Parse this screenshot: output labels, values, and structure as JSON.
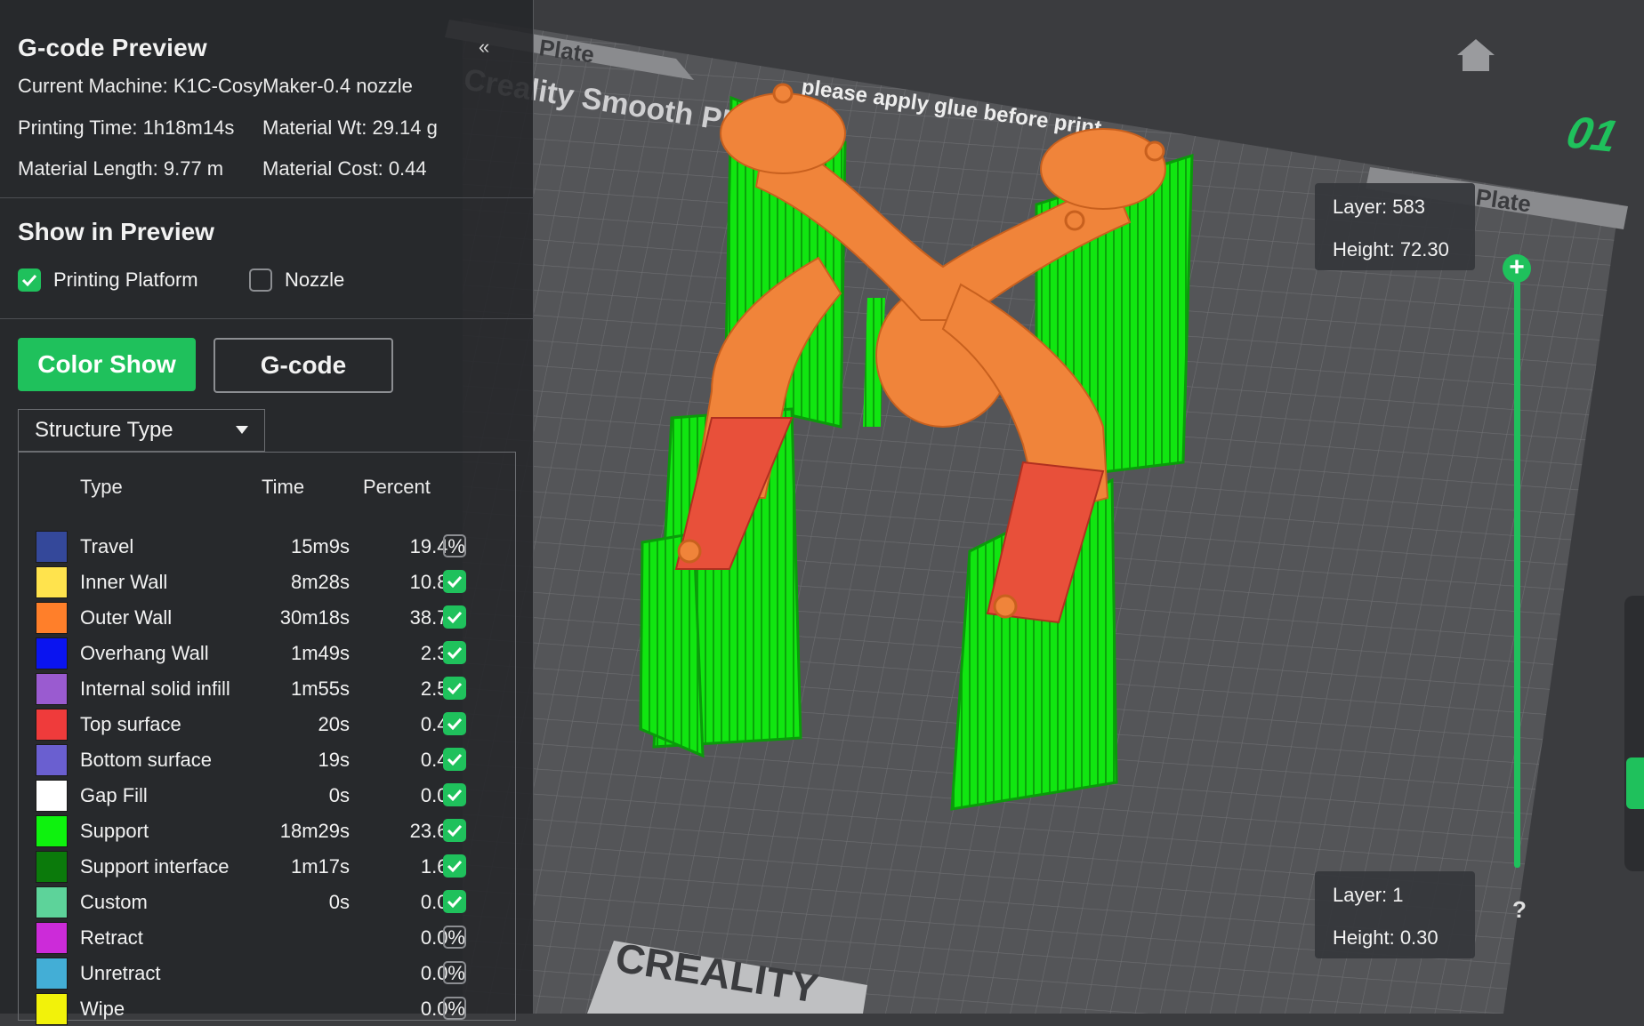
{
  "panel": {
    "title": "G-code Preview",
    "machine": "Current Machine: K1C-CosyMaker-0.4 nozzle",
    "printing_time": "Printing Time: 1h18m14s",
    "material_wt": "Material Wt: 29.14 g",
    "material_length": "Material Length: 9.77 m",
    "material_cost": "Material Cost: 0.44",
    "collapse_icon": "«"
  },
  "show_in_preview": {
    "title": "Show in Preview",
    "printing_platform": {
      "label": "Printing Platform",
      "checked": true
    },
    "nozzle": {
      "label": "Nozzle",
      "checked": false
    }
  },
  "view_mode": {
    "color_show": "Color Show",
    "gcode": "G-code",
    "active": "Color Show"
  },
  "dropdown": {
    "selected": "Structure Type"
  },
  "legend": {
    "headers": {
      "type": "Type",
      "time": "Time",
      "percent": "Percent"
    },
    "rows": [
      {
        "name": "Travel",
        "time": "15m9s",
        "percent": "19.4%",
        "color": "#34489a",
        "checked": false
      },
      {
        "name": "Inner Wall",
        "time": "8m28s",
        "percent": "10.8%",
        "color": "#ffe34d",
        "checked": true
      },
      {
        "name": "Outer Wall",
        "time": "30m18s",
        "percent": "38.7%",
        "color": "#ff7f2a",
        "checked": true
      },
      {
        "name": "Overhang Wall",
        "time": "1m49s",
        "percent": "2.3%",
        "color": "#0a14f0",
        "checked": true
      },
      {
        "name": "Internal solid infill",
        "time": "1m55s",
        "percent": "2.5%",
        "color": "#9a5bd0",
        "checked": true
      },
      {
        "name": "Top surface",
        "time": "20s",
        "percent": "0.4%",
        "color": "#ef3b3b",
        "checked": true
      },
      {
        "name": "Bottom surface",
        "time": "19s",
        "percent": "0.4%",
        "color": "#6a5fd0",
        "checked": true
      },
      {
        "name": "Gap Fill",
        "time": "0s",
        "percent": "0.0%",
        "color": "#ffffff",
        "checked": true
      },
      {
        "name": "Support",
        "time": "18m29s",
        "percent": "23.6%",
        "color": "#0ef20e",
        "checked": true
      },
      {
        "name": "Support interface",
        "time": "1m17s",
        "percent": "1.6%",
        "color": "#0b7a0b",
        "checked": true
      },
      {
        "name": "Custom",
        "time": "0s",
        "percent": "0.0%",
        "color": "#5dd39a",
        "checked": true
      },
      {
        "name": "Retract",
        "time": "",
        "percent": "0.0%",
        "color": "#cc2bd9",
        "checked": false
      },
      {
        "name": "Unretract",
        "time": "",
        "percent": "0.0%",
        "color": "#43aed6",
        "checked": false
      },
      {
        "name": "Wipe",
        "time": "",
        "percent": "0.0%",
        "color": "#f2f20a",
        "checked": false
      }
    ]
  },
  "layers": {
    "top": {
      "layer": "Layer: 583",
      "height": "Height: 72.30"
    },
    "bottom": {
      "layer": "Layer: 1",
      "height": "Height: 0.30"
    },
    "help": "?"
  },
  "plate": {
    "tab_left": "Plate",
    "tab_right": "Plate",
    "bed_text": "Creality Smooth PEI Plate",
    "glue_note": "please apply glue before print",
    "brand": "CREALITY",
    "plate_number": "01"
  },
  "colors": {
    "accent": "#1fc15c",
    "support": "#0ef20e",
    "model": "#f0843a",
    "top_surface": "#e8503a"
  }
}
